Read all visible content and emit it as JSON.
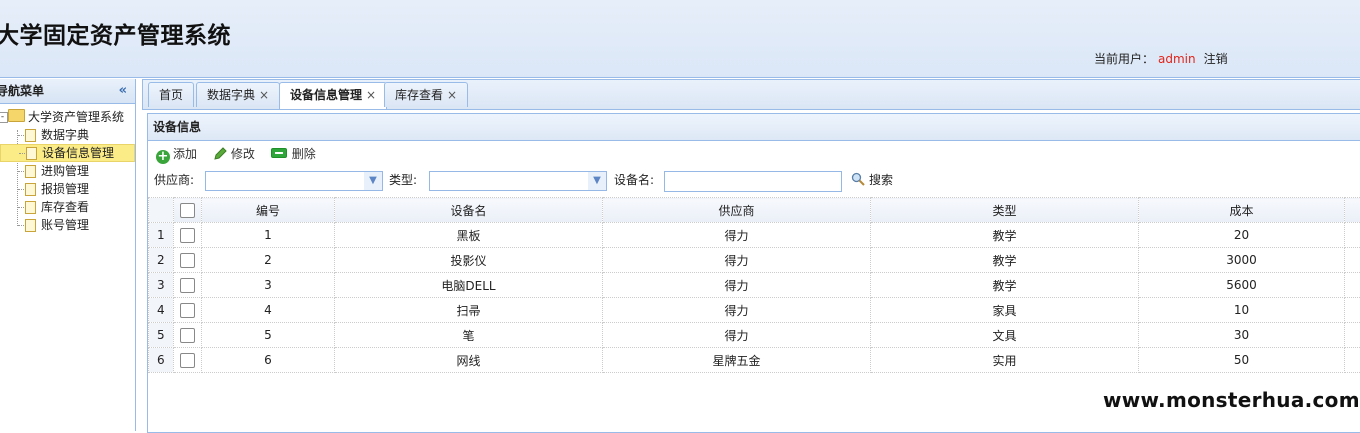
{
  "header": {
    "title": "大学固定资产管理系统",
    "user_label": "当前用户：",
    "user_name": "admin",
    "logout": "注销"
  },
  "sidebar": {
    "title": "导航菜单",
    "collapse_icon": "«",
    "root": "大学资产管理系统",
    "items": [
      {
        "label": "数据字典"
      },
      {
        "label": "设备信息管理"
      },
      {
        "label": "进购管理"
      },
      {
        "label": "报损管理"
      },
      {
        "label": "库存查看"
      },
      {
        "label": "账号管理"
      }
    ]
  },
  "tabs": [
    {
      "label": "首页",
      "closable": false
    },
    {
      "label": "数据字典",
      "closable": true
    },
    {
      "label": "设备信息管理",
      "closable": true
    },
    {
      "label": "库存查看",
      "closable": true
    }
  ],
  "tab_close": "×",
  "panel": {
    "title": "设备信息",
    "toolbar": {
      "add": "添加",
      "edit": "修改",
      "delete": "删除"
    },
    "filters": {
      "supplier_label": "供应商:",
      "type_label": "类型:",
      "name_label": "设备名:",
      "search": "搜索"
    }
  },
  "grid": {
    "columns": [
      "编号",
      "设备名",
      "供应商",
      "类型",
      "成本"
    ],
    "rows": [
      {
        "n": "1",
        "id": "1",
        "name": "黑板",
        "supplier": "得力",
        "type": "教学",
        "cost": "20"
      },
      {
        "n": "2",
        "id": "2",
        "name": "投影仪",
        "supplier": "得力",
        "type": "教学",
        "cost": "3000"
      },
      {
        "n": "3",
        "id": "3",
        "name": "电脑DELL",
        "supplier": "得力",
        "type": "教学",
        "cost": "5600"
      },
      {
        "n": "4",
        "id": "4",
        "name": "扫帚",
        "supplier": "得力",
        "type": "家具",
        "cost": "10"
      },
      {
        "n": "5",
        "id": "5",
        "name": "笔",
        "supplier": "得力",
        "type": "文具",
        "cost": "30"
      },
      {
        "n": "6",
        "id": "6",
        "name": "网线",
        "supplier": "星牌五金",
        "type": "实用",
        "cost": "50"
      }
    ]
  },
  "watermark": "www.monsterhua.com",
  "colors": {
    "accent_border": "#99bbe8",
    "user_name": "#e0251b",
    "selected_row": "#fbec88"
  }
}
